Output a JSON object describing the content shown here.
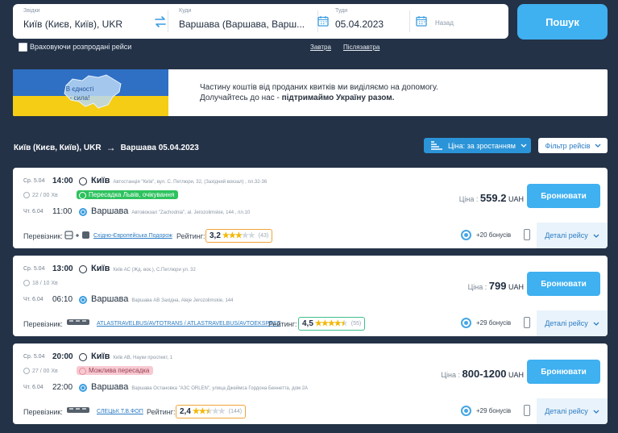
{
  "search": {
    "from_label": "Звідки",
    "from_value": "Київ (Києв,  Київ), UKR",
    "to_label": "Куди",
    "to_value": "Варшава (Варшава,  Варш...",
    "date_label": "Туди",
    "date_value": "05.04.2023",
    "return_label": "Назад",
    "search_button": "Пошук",
    "sold_out_label": "Враховуючи розпродані рейси",
    "tomorrow_link": "Завтра",
    "day_after_link": "Післязавтра"
  },
  "banner": {
    "flag_text": "В єдності - сила!",
    "line1": "Частину коштів від проданих квитків ми виділяємо на допомогу.",
    "line2_prefix": "Долучайтесь до нас - ",
    "line2_bold": "підтримаймо Україну разом."
  },
  "results": {
    "from": "Київ (Києв, Київ), UKR",
    "arrow": "→",
    "to_date": "Варшава 05.04.2023",
    "sort_label": "Ціна: за зростанням",
    "filter_label": "Фільтр рейсів"
  },
  "trips": [
    {
      "dep_date": "Ср. 5.04",
      "dep_time": "14:00",
      "dep_city": "Київ",
      "dep_station": "Автостанція \"Київ\", вул. С. Петлюри, 32, (Західний вокзал) , пл.32-36",
      "duration": "22 / 00 Хв",
      "transfer": "Пересадка Львів, очікування",
      "arr_date": "Чт. 6.04",
      "arr_time": "11:00",
      "arr_city": "Варшава",
      "arr_station": "Автовокзал \"Zachodnia\", al. Jerozolimskie, 144 , пл.10",
      "carrier_label": "Перевізник:",
      "carrier": "Східно-Європейська Подорож",
      "rating_label": "Рейтинг:",
      "rating": "3,2",
      "stars": 3,
      "reviews": "(43)",
      "price_label": "Ціна :",
      "price": "559.2",
      "currency": "UAH",
      "book": "Бронювати",
      "bonus": "+20 бонусів",
      "details": "Деталі рейсу"
    },
    {
      "dep_date": "Ср. 5.04",
      "dep_time": "13:00",
      "dep_city": "Київ",
      "dep_station": "Київ АС (Жд. вок.), С.Петлюри ул. 32",
      "duration": "18 / 10 Хв",
      "transfer": "",
      "arr_date": "Чт. 6.04",
      "arr_time": "06:10",
      "arr_city": "Варшава",
      "arr_station": "Варшава АВ Західна, Aleje Jerozolimskie, 144",
      "carrier_label": "Перевізник:",
      "carrier": "ATLASTRAVELBUS/AVTOTRANS / ATLASTRAVELBUS/AVTOEKSPRES",
      "rating_label": "Рейтинг:",
      "rating": "4,5",
      "stars": 4.5,
      "reviews": "(55)",
      "price_label": "Ціна :",
      "price": "799",
      "currency": "UAH",
      "book": "Бронювати",
      "bonus": "+29 бонусів",
      "details": "Деталі рейсу"
    },
    {
      "dep_date": "Ср. 5.04",
      "dep_time": "20:00",
      "dep_city": "Київ",
      "dep_station": "Київ АВ, Науки проспект, 1",
      "duration": "27 / 00 Хв",
      "transfer": "Можлива пересадка",
      "arr_date": "Чт. 6.04",
      "arr_time": "22:00",
      "arr_city": "Варшава",
      "arr_station": "Варшава Остановка \"АЗС ORLEN\", улица Джеймса Гордона Беннетта, дом 2А",
      "carrier_label": "Перевізник:",
      "carrier": "СЛЕЦЬК Т.В.ФОП",
      "rating_label": "Рейтинг:",
      "rating": "2,4",
      "stars": 2.5,
      "reviews": "(144)",
      "price_label": "Ціна :",
      "price": "800-1200",
      "currency": "UAH",
      "book": "Бронювати",
      "bonus": "+29 бонусів",
      "details": "Деталі рейсу"
    }
  ],
  "colors": {
    "page_bg": "#243247",
    "accent": "#3fb0f0",
    "transfer_green": "#2dc25e",
    "transfer_pink": "#f7c9d1",
    "rating_orange": "#f0a33a",
    "rating_green": "#3fbf8a"
  },
  "icons": [
    "swap-icon",
    "calendar-icon",
    "clock-icon",
    "bus-icon",
    "train-icon",
    "eye-icon",
    "phone-icon",
    "chevron-down-icon",
    "sort-icon",
    "arrow-right-icon",
    "map-icon"
  ]
}
